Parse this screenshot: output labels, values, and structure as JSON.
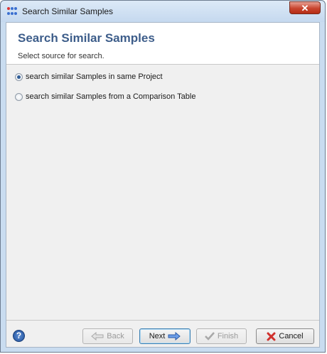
{
  "window": {
    "title": "Search Similar Samples",
    "close_label": "✕"
  },
  "header": {
    "title": "Search Similar Samples",
    "subtitle": "Select source for search."
  },
  "options": [
    {
      "label": "search similar Samples in same Project",
      "checked": true
    },
    {
      "label": "search similar Samples from a Comparison Table",
      "checked": false
    }
  ],
  "footer": {
    "help_label": "?",
    "back_label": "Back",
    "next_label": "Next",
    "finish_label": "Finish",
    "cancel_label": "Cancel"
  },
  "colors": {
    "title_blue": "#3d5d8a",
    "cancel_red": "#d0312d",
    "next_arrow": "#4a7fd4"
  }
}
